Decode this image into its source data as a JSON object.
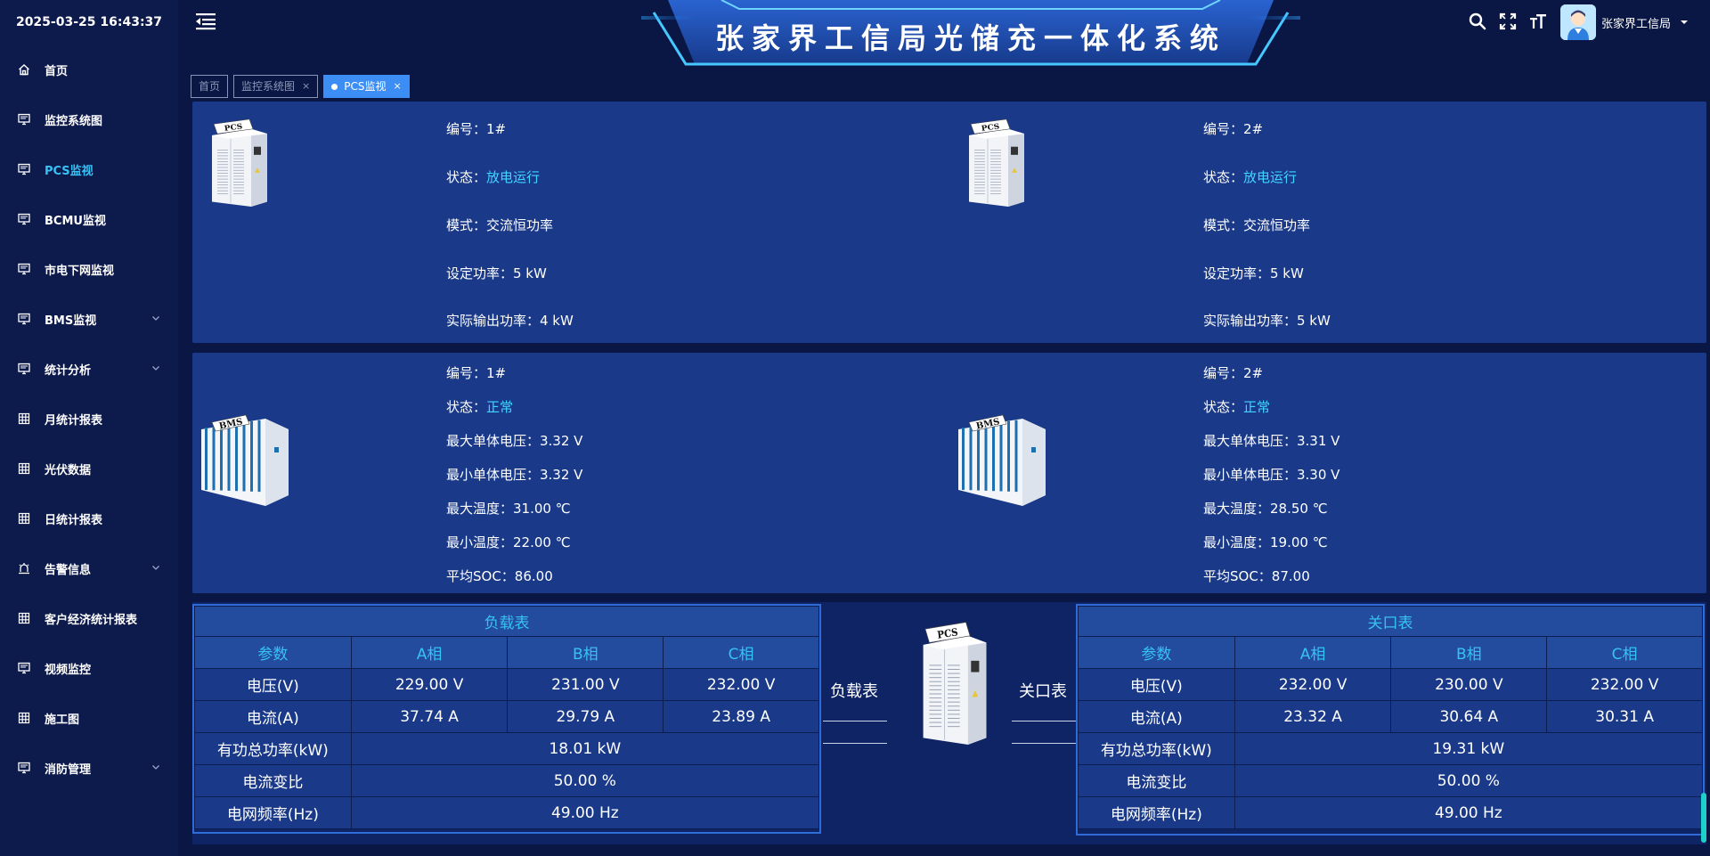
{
  "datetime": "2025-03-25 16:43:37",
  "sidebar": {
    "items": [
      {
        "label": "首页",
        "icon": "home-icon"
      },
      {
        "label": "监控系统图",
        "icon": "monitor-icon"
      },
      {
        "label": "PCS监视",
        "icon": "monitor-icon",
        "active": true
      },
      {
        "label": "BCMU监视",
        "icon": "monitor-icon"
      },
      {
        "label": "市电下网监视",
        "icon": "monitor-icon"
      },
      {
        "label": "BMS监视",
        "icon": "monitor-icon",
        "expandable": true
      },
      {
        "label": "统计分析",
        "icon": "monitor-icon",
        "expandable": true
      },
      {
        "label": "月统计报表",
        "icon": "grid-icon"
      },
      {
        "label": "光伏数据",
        "icon": "grid-icon"
      },
      {
        "label": "日统计报表",
        "icon": "grid-icon"
      },
      {
        "label": "告警信息",
        "icon": "alarm-icon",
        "expandable": true
      },
      {
        "label": "客户经济统计报表",
        "icon": "grid-icon"
      },
      {
        "label": "视频监控",
        "icon": "monitor-icon"
      },
      {
        "label": "施工图",
        "icon": "grid-icon"
      },
      {
        "label": "消防管理",
        "icon": "monitor-icon",
        "expandable": true
      }
    ]
  },
  "header": {
    "title": "张家界工信局光储充一体化系统",
    "user_name": "张家界工信局"
  },
  "tabs": [
    {
      "label": "首页"
    },
    {
      "label": "监控系统图"
    },
    {
      "label": "PCS监视"
    }
  ],
  "pcs": [
    {
      "image_label": "PCS",
      "id": "编号：1#",
      "status_label": "状态：",
      "status_value": "放电运行",
      "mode": "模式：交流恒功率",
      "set_power": "设定功率：5 kW",
      "actual_power": "实际输出功率：4 kW"
    },
    {
      "image_label": "PCS",
      "id": "编号：2#",
      "status_label": "状态：",
      "status_value": "放电运行",
      "mode": "模式：交流恒功率",
      "set_power": "设定功率：5 kW",
      "actual_power": "实际输出功率：5 kW"
    }
  ],
  "bms": [
    {
      "image_label": "BMS",
      "id": "编号：1#",
      "status_label": "状态：",
      "status_value": "正常",
      "max_v": "最大单体电压：3.32 V",
      "min_v": "最小单体电压：3.32 V",
      "max_t": "最大温度：31.00 ℃",
      "min_t": "最小温度：22.00 ℃",
      "soc": "平均SOC：86.00"
    },
    {
      "image_label": "BMS",
      "id": "编号：2#",
      "status_label": "状态：",
      "status_value": "正常",
      "max_v": "最大单体电压：3.31 V",
      "min_v": "最小单体电压：3.30 V",
      "max_t": "最大温度：28.50 ℃",
      "min_t": "最小温度：19.00 ℃",
      "soc": "平均SOC：87.00"
    }
  ],
  "load_meter": {
    "caption": "负载表",
    "headers": [
      "参数",
      "A相",
      "B相",
      "C相"
    ],
    "voltage": [
      "电压(V)",
      "229.00 V",
      "231.00 V",
      "232.00 V"
    ],
    "current": [
      "电流(A)",
      "37.74 A",
      "29.79 A",
      "23.89 A"
    ],
    "power": [
      "有功总功率(kW)",
      "18.01 kW"
    ],
    "ct_ratio": [
      "电流变比",
      "50.00 %"
    ],
    "frequency": [
      "电网频率(Hz)",
      "49.00 Hz"
    ]
  },
  "gate_meter": {
    "caption": "关口表",
    "headers": [
      "参数",
      "A相",
      "B相",
      "C相"
    ],
    "voltage": [
      "电压(V)",
      "232.00 V",
      "230.00 V",
      "232.00 V"
    ],
    "current": [
      "电流(A)",
      "23.32 A",
      "30.64 A",
      "30.31 A"
    ],
    "power": [
      "有功总功率(kW)",
      "19.31 kW"
    ],
    "ct_ratio": [
      "电流变比",
      "50.00 %"
    ],
    "frequency": [
      "电网频率(Hz)",
      "49.00 Hz"
    ]
  },
  "center": {
    "left_label": "负载表",
    "right_label": "关口表",
    "image_label": "PCS"
  },
  "colors": {
    "background": "#0a1744",
    "panel": "#1a3a89",
    "accent": "#37c2f5",
    "status": "#3fd6ff",
    "active_tab": "#3d8ef4"
  }
}
